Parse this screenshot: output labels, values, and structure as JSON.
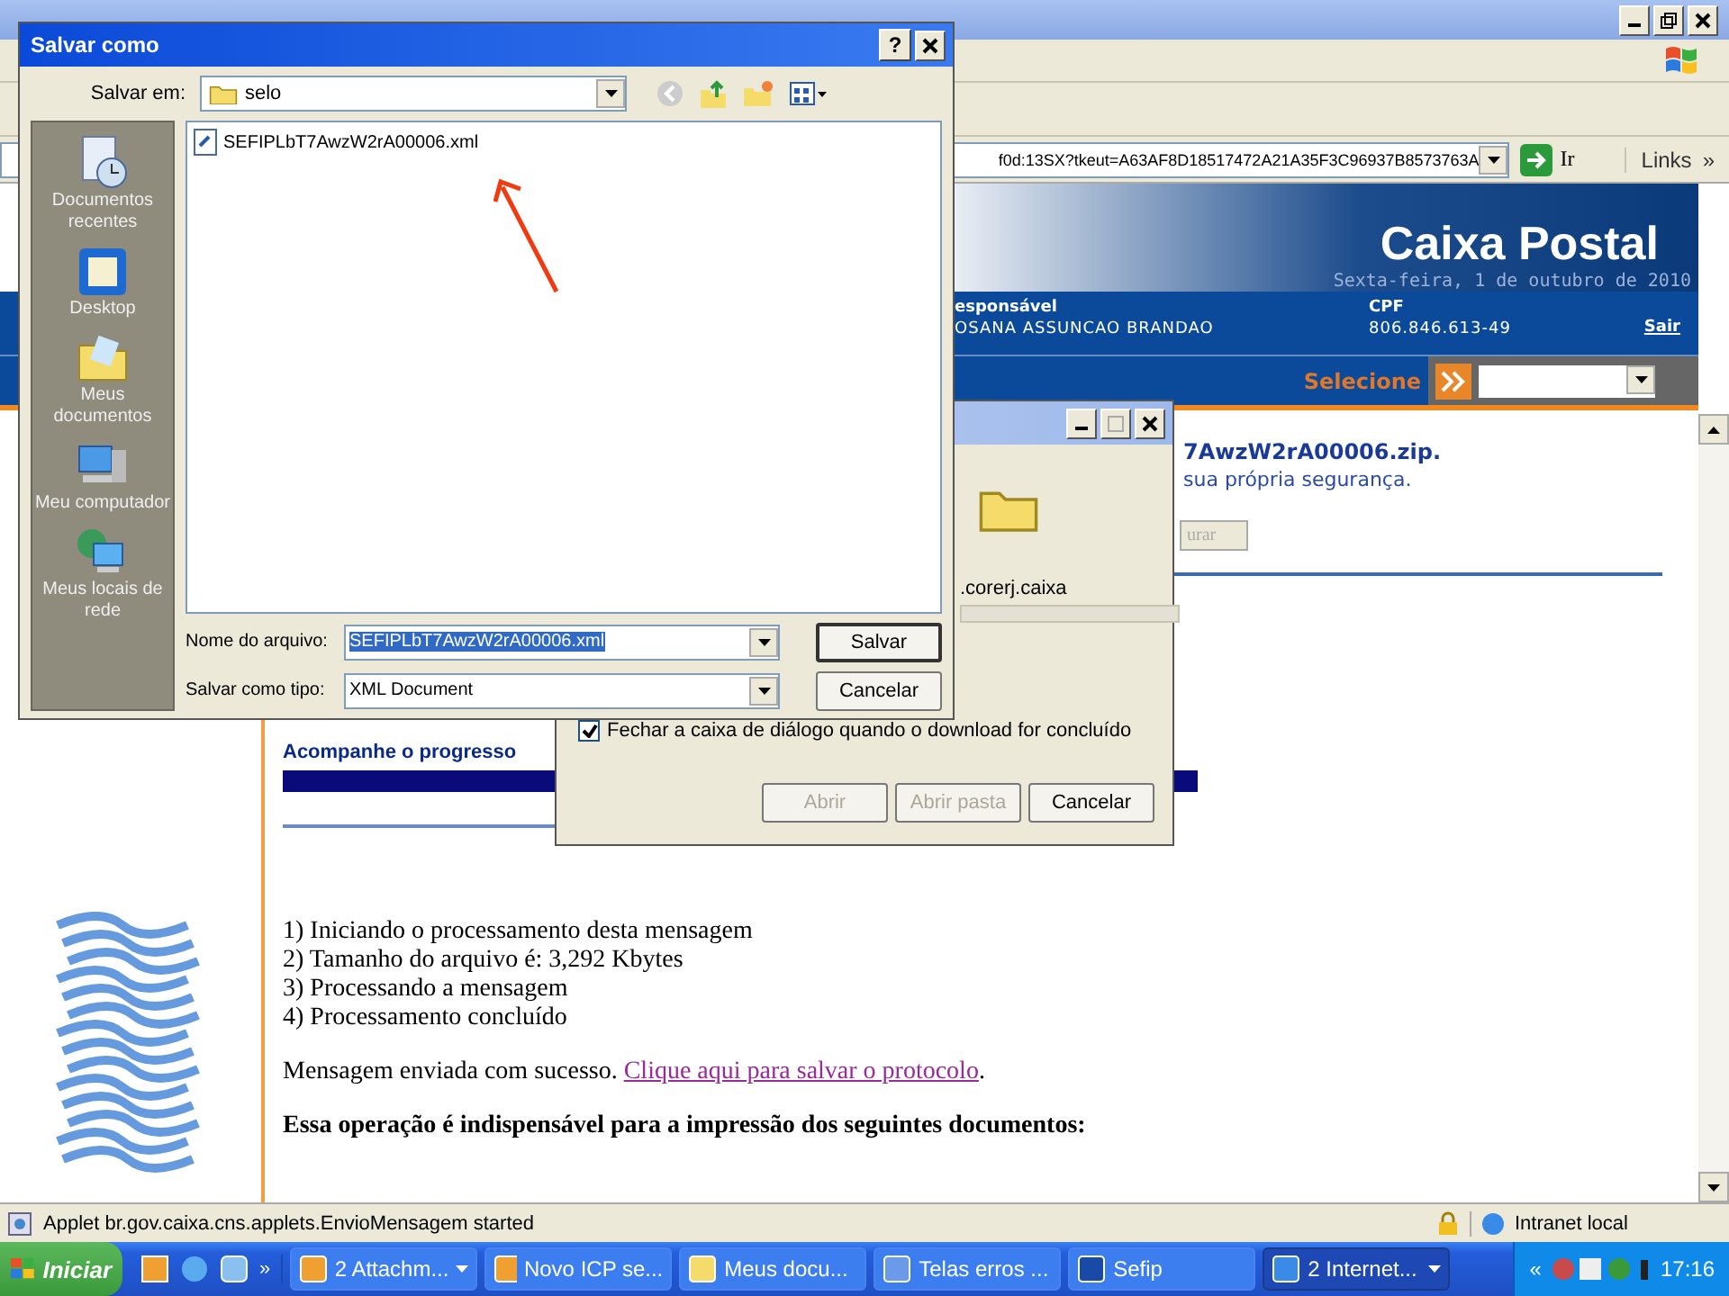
{
  "browser": {
    "address": "f0d:13SX?tkeut=A63AF8D18517472A21A35F3C96937B8573763A",
    "go": "Ir",
    "links": "Links",
    "links_more": "»"
  },
  "page": {
    "banner_title": "Caixa Postal",
    "date": "Sexta-feira, 1 de outubro de 2010",
    "user_label": "esponsável",
    "user_name": "OSANA ASSUNCAO BRANDAO",
    "cpf_label": "CPF",
    "cpf": "806.846.613-49",
    "logout": "Sair",
    "nav_label": "Selecione",
    "download_name": "7AwzW2rA00006.zip.",
    "security_note": "sua própria segurança.",
    "browse_button": {
      "label": "urar",
      "disabled": true
    },
    "progress_title": "Acompanhe o progresso",
    "progress": {
      "level": 1
    },
    "steps": [
      "1) Iniciando o processamento desta mensagem",
      "2) Tamanho do arquivo é: 3,292 Kbytes",
      "3) Processando a mensagem",
      "4) Processamento concluído"
    ],
    "message": "Mensagem enviada com sucesso.",
    "protocol_link": "Clique aqui para salvar o protocolo",
    "link_suffix": ".",
    "note": "Essa operação é indispensável para a impressão dos seguintes documentos:"
  },
  "status_bar": {
    "text": "Applet br.gov.caixa.cns.applets.EnvioMensagem started",
    "zone": "Intranet local"
  },
  "download_dialog": {
    "host": ".corerj.caixa",
    "close_when_done": {
      "label": "Fechar a caixa de diálogo quando o download for concluído",
      "checked": true
    },
    "buttons": [
      {
        "label": "Abrir",
        "disabled": true
      },
      {
        "label": "Abrir pasta",
        "disabled": true
      },
      {
        "label": "Cancelar",
        "disabled": false
      }
    ]
  },
  "save_dialog": {
    "title": "Salvar como",
    "help": "?",
    "look_in_label": "Salvar em:",
    "look_in": "selo",
    "places": [
      {
        "kind": "recent",
        "label": "Documentos recentes"
      },
      {
        "kind": "desktop",
        "label": "Desktop"
      },
      {
        "kind": "documents",
        "label": "Meus documentos"
      },
      {
        "kind": "computer",
        "label": "Meu computador"
      },
      {
        "kind": "network",
        "label": "Meus locais de rede"
      }
    ],
    "files": [
      {
        "name": "SEFIPLbT7AwzW2rA00006.xml"
      }
    ],
    "filename_label": "Nome do arquivo:",
    "filename": "SEFIPLbT7AwzW2rA00006.xml",
    "type_label": "Salvar como tipo:",
    "type": "XML Document",
    "buttons": [
      {
        "label": "Salvar",
        "default": true
      },
      {
        "label": "Cancelar",
        "default": false
      }
    ]
  },
  "taskbar": {
    "start": "Iniciar",
    "more": "»",
    "tasks": [
      {
        "label": "2 Attachm...",
        "grouped": true,
        "selected": false
      },
      {
        "label": "Novo ICP se...",
        "grouped": false,
        "selected": false
      },
      {
        "label": "Meus docu...",
        "grouped": false,
        "selected": false
      },
      {
        "label": "Telas erros ...",
        "grouped": false,
        "selected": false
      },
      {
        "label": "Sefip",
        "grouped": false,
        "selected": false
      },
      {
        "label": "2 Internet...",
        "grouped": true,
        "selected": true
      }
    ],
    "tray_more": "«",
    "clock": "17:16"
  }
}
